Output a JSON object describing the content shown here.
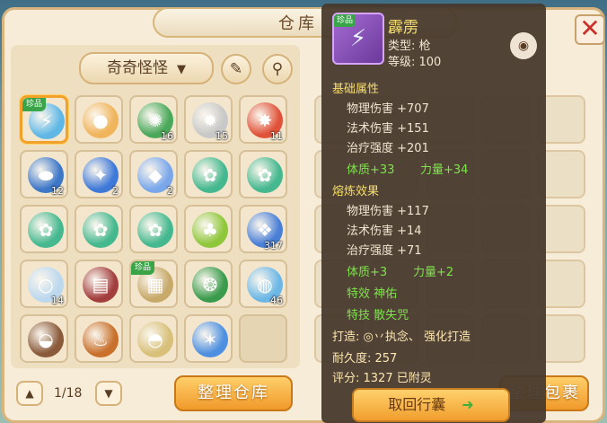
{
  "header": {
    "title": "仓库",
    "close_icon": "close-icon"
  },
  "filter": {
    "label": "奇奇怪怪",
    "chevron_icon": "chevron-down-icon",
    "edit_icon": "pencil-icon",
    "search_icon": "search-icon"
  },
  "grid": {
    "rows": [
      [
        {
          "icon": "spear-icon",
          "color": "#5fb7e6",
          "qty": "",
          "tag": "珍品",
          "selected": true
        },
        {
          "icon": "orb-icon",
          "color": "#f0b45a",
          "qty": "",
          "tag": ""
        },
        {
          "icon": "jade-orb-icon",
          "color": "#4aa85a",
          "qty": "16",
          "tag": ""
        },
        {
          "icon": "white-beast-icon",
          "color": "#c8c8c8",
          "qty": "15",
          "tag": ""
        },
        {
          "icon": "fire-orb-icon",
          "color": "#e0533a",
          "qty": "11",
          "tag": ""
        }
      ],
      [
        {
          "icon": "turtle-shell-icon",
          "color": "#3d77c8",
          "qty": "12",
          "tag": ""
        },
        {
          "icon": "crystal-cluster-icon",
          "color": "#3f79d8",
          "qty": "2",
          "tag": ""
        },
        {
          "icon": "crystal-shard-icon",
          "color": "#7aa7ea",
          "qty": "2",
          "tag": ""
        },
        {
          "icon": "spirit-orb-icon",
          "color": "#45b88f",
          "qty": "",
          "tag": ""
        },
        {
          "icon": "spirit-orb-icon",
          "color": "#45b88f",
          "qty": "",
          "tag": ""
        }
      ],
      [
        {
          "icon": "spirit-orb-icon",
          "color": "#45b88f",
          "qty": "",
          "tag": ""
        },
        {
          "icon": "spirit-orb-icon",
          "color": "#45b88f",
          "qty": "",
          "tag": ""
        },
        {
          "icon": "spirit-orb-icon",
          "color": "#45b88f",
          "qty": "",
          "tag": ""
        },
        {
          "icon": "sprout-pet-icon",
          "color": "#8fc73b",
          "qty": "",
          "tag": ""
        },
        {
          "icon": "ice-crystal-icon",
          "color": "#4a7fd6",
          "qty": "317",
          "tag": ""
        }
      ],
      [
        {
          "icon": "pearl-icon",
          "color": "#bcd8ee",
          "qty": "14",
          "tag": ""
        },
        {
          "icon": "book-icon",
          "color": "#a33e3e",
          "qty": "",
          "tag": ""
        },
        {
          "icon": "scroll-map-icon",
          "color": "#c7a96a",
          "qty": "",
          "tag": "珍品"
        },
        {
          "icon": "jade-token-icon",
          "color": "#3a9b4c",
          "qty": "",
          "tag": ""
        },
        {
          "icon": "water-orb-icon",
          "color": "#6cb7e6",
          "qty": "46",
          "tag": ""
        }
      ],
      [
        {
          "icon": "food-plate-icon",
          "color": "#8a5a3a",
          "qty": "",
          "tag": ""
        },
        {
          "icon": "roast-chicken-icon",
          "color": "#c8702c",
          "qty": "",
          "tag": ""
        },
        {
          "icon": "noodle-bowl-icon",
          "color": "#d8c07a",
          "qty": "",
          "tag": ""
        },
        {
          "icon": "ice-star-icon",
          "color": "#4d8fe0",
          "qty": "",
          "tag": ""
        },
        {
          "icon": "",
          "color": "",
          "qty": "",
          "tag": "",
          "empty": true
        }
      ]
    ]
  },
  "pager": {
    "text": "1/18",
    "up_icon": "chevron-up-icon",
    "down_icon": "chevron-down-icon"
  },
  "buttons": {
    "organize": "整理仓库",
    "organize_bag": "整理包裹"
  },
  "tooltip": {
    "name": "霹雳",
    "type": "类型: 枪",
    "level": "等级: 100",
    "eye_icon": "eye-icon",
    "base_header": "基础属性",
    "base_stats": [
      "物理伤害 +707",
      "法术伤害 +151",
      "治疗强度 +201"
    ],
    "base_bonus": [
      "体质+33",
      "力量+34"
    ],
    "refine_header": "熔炼效果",
    "refine_stats": [
      "物理伤害 +117",
      "法术伤害 +14",
      "治疗强度 +71"
    ],
    "refine_bonus": [
      "体质+3",
      "力量+2"
    ],
    "effect": "特效  神佑",
    "skill": "特技  散失咒",
    "forge": "打造: ◎丷执念、     强化打造",
    "durability": "耐久度: 257",
    "score": "评分: 1327   已附灵",
    "take_label": "取回行囊"
  },
  "colors": {
    "accent": "#f09a2a",
    "tooltip_bg": "#46382c",
    "rare": "#3aa548"
  }
}
